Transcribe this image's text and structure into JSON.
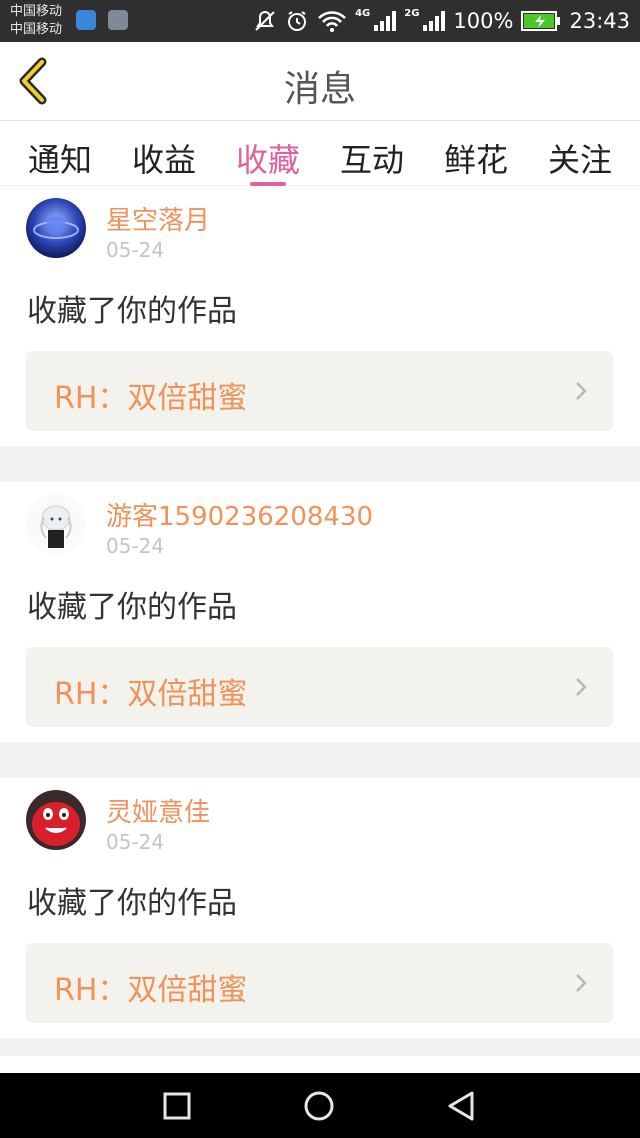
{
  "status_bar": {
    "carrier1": "中国移动",
    "carrier2": "中国移动",
    "network_4g": "4G",
    "network_2g": "2G",
    "battery": "100%",
    "time": "23:43"
  },
  "header": {
    "title": "消息"
  },
  "tabs": [
    {
      "label": "通知"
    },
    {
      "label": "收益"
    },
    {
      "label": "收藏",
      "active": true
    },
    {
      "label": "互动"
    },
    {
      "label": "鲜花"
    },
    {
      "label": "关注"
    }
  ],
  "messages": [
    {
      "username": "星空落月",
      "date": "05-24",
      "action": "收藏了你的作品",
      "work": "RH：双倍甜蜜"
    },
    {
      "username": "游客1590236208430",
      "date": "05-24",
      "action": "收藏了你的作品",
      "work": "RH：双倍甜蜜"
    },
    {
      "username": "灵娅意佳",
      "date": "05-24",
      "action": "收藏了你的作品",
      "work": "RH：双倍甜蜜"
    }
  ],
  "colors": {
    "accent": "#e060a0",
    "username": "#f0925a",
    "work_bg": "#f4f2ec"
  }
}
